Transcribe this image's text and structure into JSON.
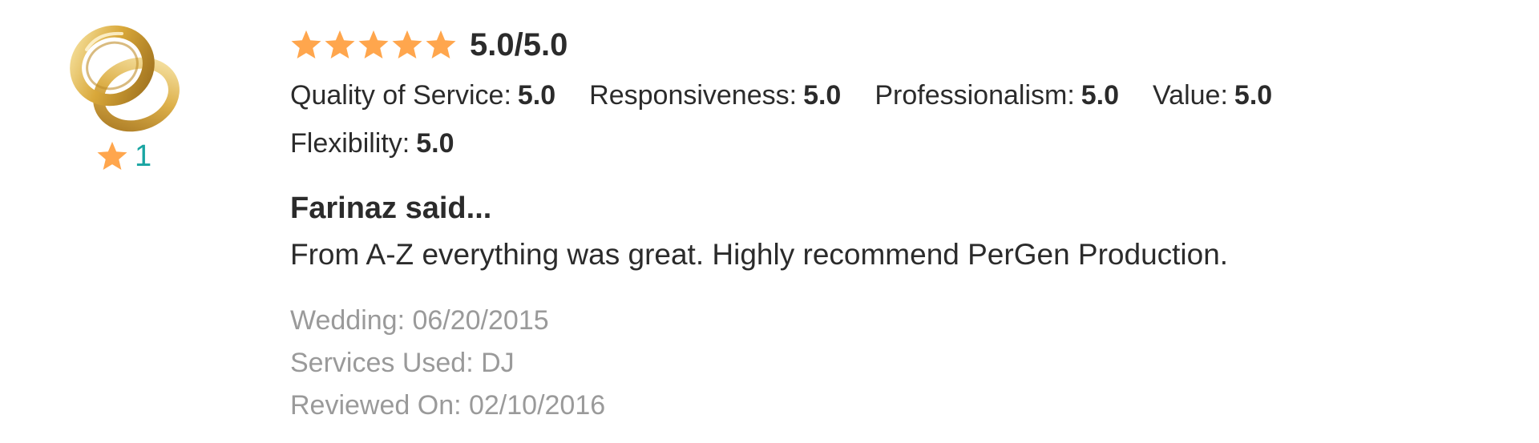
{
  "vendor": {
    "avatar_icon": "wedding-rings-icon",
    "badge_icon": "star-icon",
    "badge_count": "1"
  },
  "review": {
    "stars": 5,
    "overall_rating": "5.0/5.0",
    "star_color": "#ffa64d",
    "subratings": [
      {
        "label": "Quality of Service:",
        "value": "5.0"
      },
      {
        "label": "Responsiveness:",
        "value": "5.0"
      },
      {
        "label": "Professionalism:",
        "value": "5.0"
      },
      {
        "label": "Value:",
        "value": "5.0"
      },
      {
        "label": "Flexibility:",
        "value": "5.0"
      }
    ],
    "reviewer_heading": "Farinaz said...",
    "text": "From A-Z everything was great. Highly recommend PerGen Production.",
    "meta": {
      "wedding": "Wedding: 06/20/2015",
      "services": "Services Used: DJ",
      "reviewed": "Reviewed On: 02/10/2016"
    }
  },
  "colors": {
    "accent_teal": "#19a5a2",
    "text_dark": "#2b2b2b",
    "text_muted": "#9a9a9a",
    "gold": "#d9a83a"
  }
}
